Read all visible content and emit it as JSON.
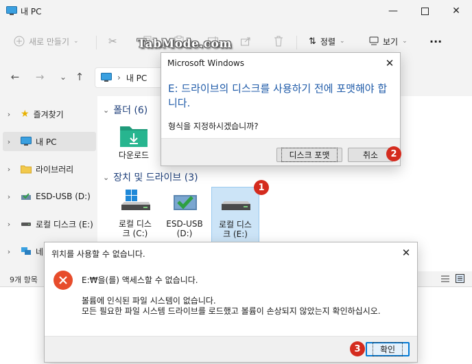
{
  "window": {
    "title": "내 PC"
  },
  "toolbar": {
    "new_label": "새로 만들기",
    "sort_label": "정렬",
    "view_label": "보기",
    "more": "···"
  },
  "address": {
    "location": "내 PC"
  },
  "sidebar": {
    "items": [
      {
        "label": "즐겨찾기",
        "icon": "star-icon"
      },
      {
        "label": "내 PC",
        "icon": "monitor-icon"
      },
      {
        "label": "라이브러리",
        "icon": "folder-icon"
      },
      {
        "label": "ESD-USB (D:)",
        "icon": "usb-drive-icon"
      },
      {
        "label": "로컬 디스크 (E:)",
        "icon": "drive-icon"
      },
      {
        "label": "네",
        "icon": "network-icon"
      }
    ]
  },
  "content": {
    "folders_header": "폴더 (6)",
    "folder_download_label": "다운로드",
    "devices_header": "장치 및 드라이브 (3)",
    "drives": [
      {
        "label": "로컬 디스\n크 (C:)"
      },
      {
        "label": "ESD-USB\n(D:)"
      },
      {
        "label": "로컬 디스\n크 (E:)"
      }
    ]
  },
  "status": {
    "item_count": "9개 항목"
  },
  "format_dialog": {
    "title": "Microsoft Windows",
    "heading": "E: 드라이브의 디스크를 사용하기 전에 포맷해야 합니다.",
    "question": "형식을 지정하시겠습니까?",
    "format_button": "디스크 포맷",
    "cancel_button": "취소"
  },
  "error_dialog": {
    "title": "위치를 사용할 수 없습니다.",
    "message_main": "E:₩을(를) 액세스할 수 없습니다.",
    "detail_line1": "볼륨에 인식된 파일 시스템이 없습니다.",
    "detail_line2": "모든 필요한 파일 시스템 드라이브를 로드했고 볼륨이 손상되지 않았는지 확인하십시오.",
    "ok_button": "확인"
  },
  "badges": {
    "one": "1",
    "two": "2",
    "three": "3"
  },
  "watermark": "TabMode.com",
  "colors": {
    "accent": "#0078d4",
    "heading_blue": "#1e5aa8",
    "badge_red": "#d42b1e",
    "error_red": "#e74c2b"
  }
}
